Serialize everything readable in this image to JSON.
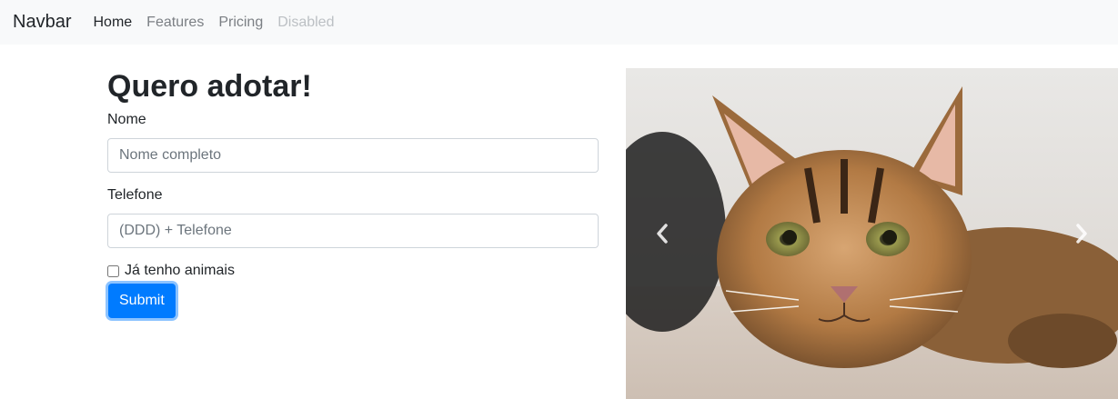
{
  "navbar": {
    "brand": "Navbar",
    "links": [
      {
        "label": "Home",
        "state": "active"
      },
      {
        "label": "Features",
        "state": "normal"
      },
      {
        "label": "Pricing",
        "state": "normal"
      },
      {
        "label": "Disabled",
        "state": "disabled"
      }
    ]
  },
  "form": {
    "title": "Quero adotar!",
    "name_label": "Nome",
    "name_placeholder": "Nome completo",
    "phone_label": "Telefone",
    "phone_placeholder": "(DDD) + Telefone",
    "checkbox_label": "Já tenho animais",
    "submit_label": "Submit"
  },
  "carousel": {
    "image": "tabby-cat-photo",
    "prev_icon": "chevron-left-icon",
    "next_icon": "chevron-right-icon"
  },
  "colors": {
    "primary": "#007bff",
    "navbar_bg": "#f8f9fa"
  }
}
